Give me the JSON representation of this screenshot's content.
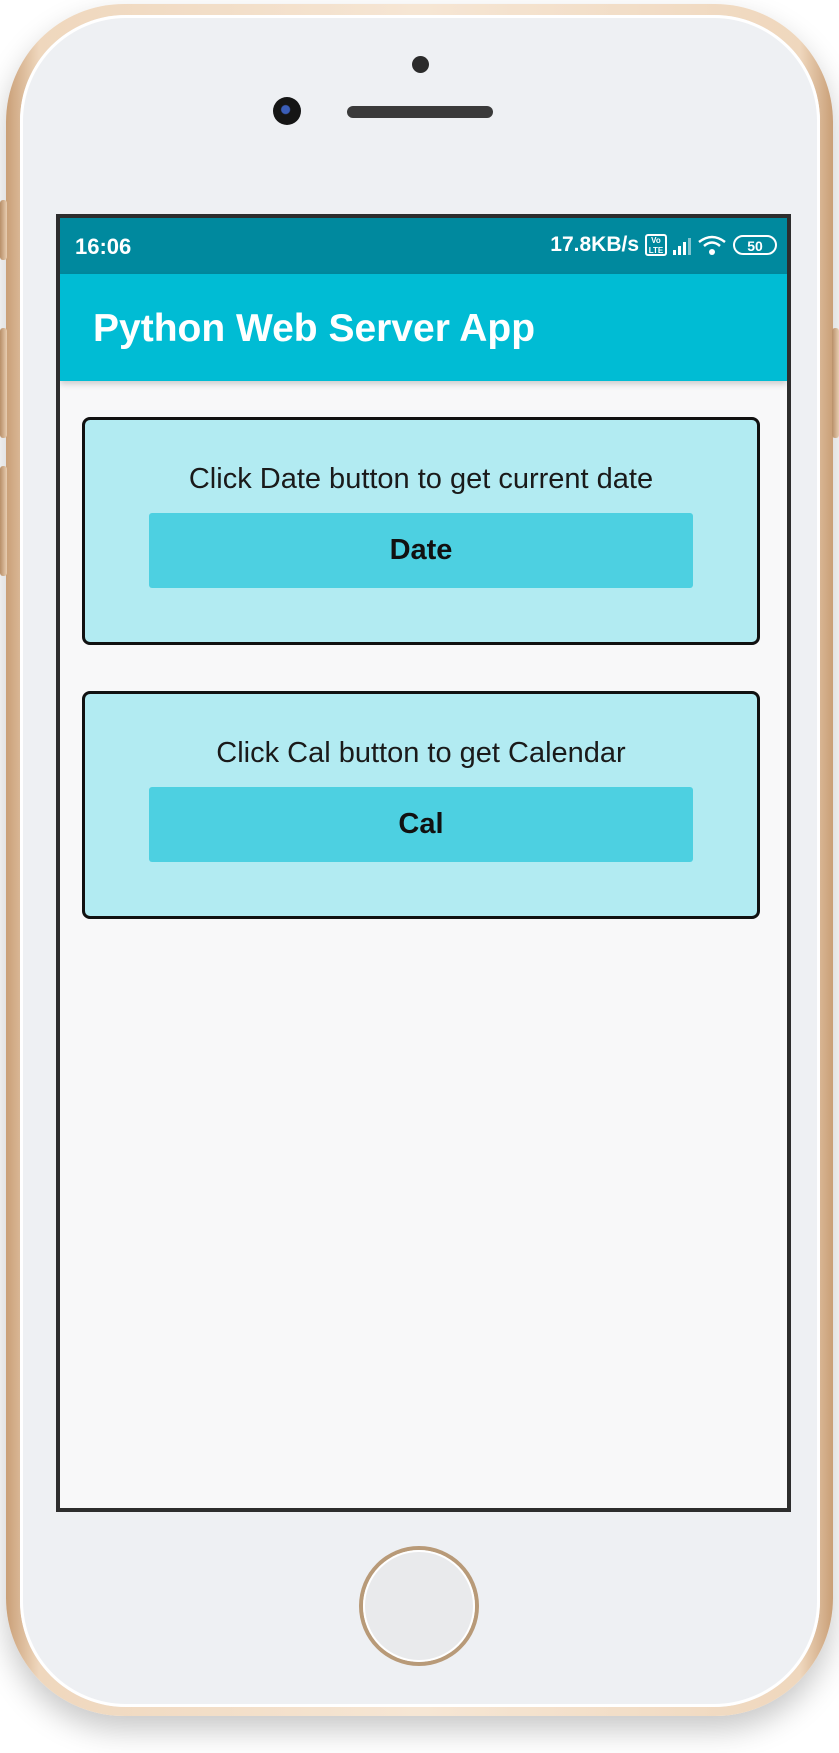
{
  "status_bar": {
    "time": "16:06",
    "network_speed": "17.8KB/s",
    "volte_badge": "Vo LTE",
    "battery_level": "50",
    "signal_icon": "signal-bars-icon",
    "wifi_icon": "wifi-icon",
    "background_color": "#00899e"
  },
  "app_bar": {
    "title": "Python Web Server App",
    "background_color": "#00bcd4"
  },
  "cards": [
    {
      "description": "Click Date button to get current date",
      "button_label": "Date"
    },
    {
      "description": "Click Cal button to get Calendar",
      "button_label": "Cal"
    }
  ],
  "colors": {
    "card_background": "#b2ebf2",
    "button_background": "#4dd0e1",
    "screen_background": "#f8f8f9"
  }
}
